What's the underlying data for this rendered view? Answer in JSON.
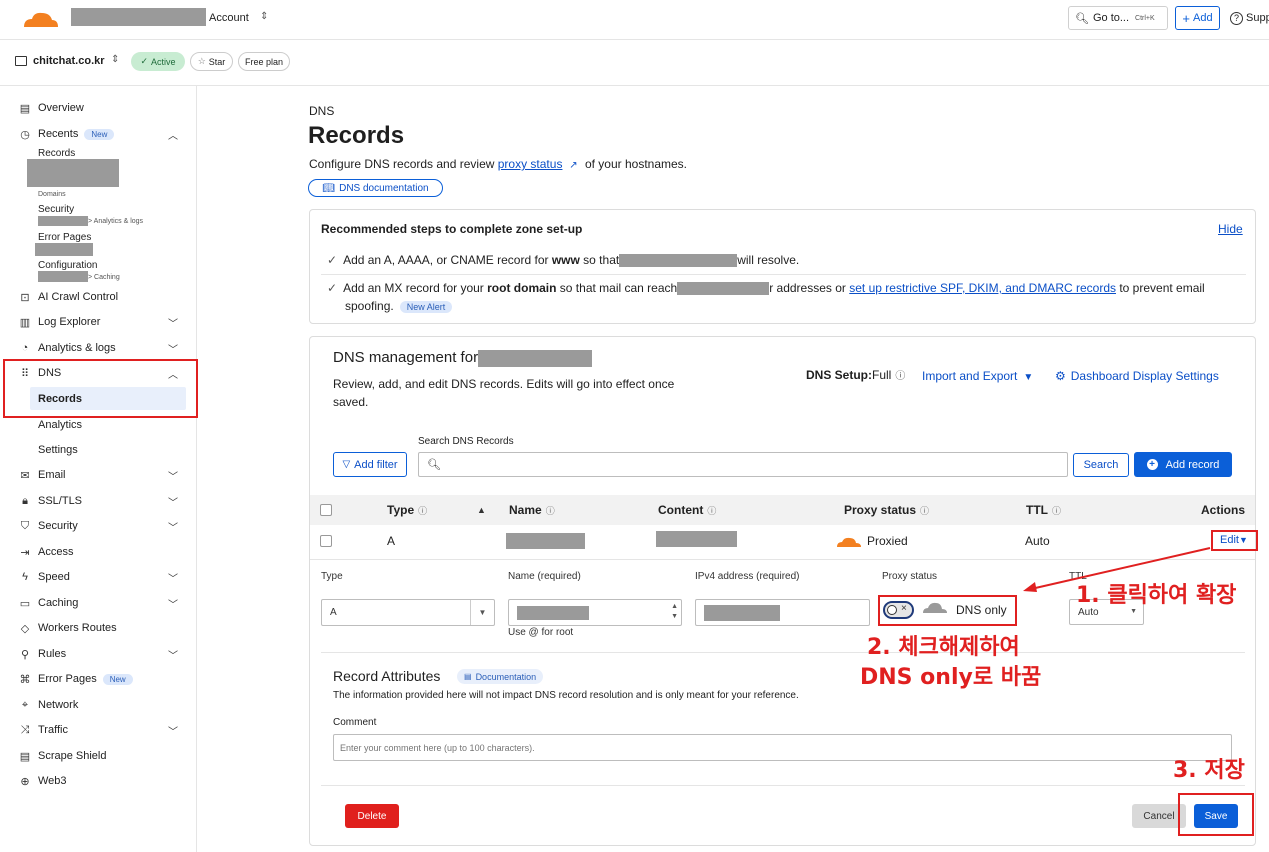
{
  "topbar": {
    "account_label": "Account",
    "goto_label": "Go to...",
    "goto_shortcut": "Ctrl+K",
    "add_label": "Add",
    "support_label": "Supp"
  },
  "zone": {
    "name": "chitchat.co.kr",
    "status": "Active",
    "star": "Star",
    "plan": "Free plan"
  },
  "sidebar": {
    "overview": "Overview",
    "recents": "Recents",
    "recents_badge": "New",
    "recent_records": "Records",
    "recent_domains": "Domains",
    "recent_security": "Security",
    "recent_security_sub": "> Analytics & logs",
    "recent_error_pages": "Error Pages",
    "recent_configuration": "Configuration",
    "recent_configuration_sub": "> Caching",
    "ai_crawl": "AI Crawl Control",
    "log_explorer": "Log Explorer",
    "analytics_logs": "Analytics & logs",
    "dns": "DNS",
    "dns_records": "Records",
    "dns_analytics": "Analytics",
    "dns_settings": "Settings",
    "email": "Email",
    "ssl": "SSL/TLS",
    "security": "Security",
    "access": "Access",
    "speed": "Speed",
    "caching": "Caching",
    "workers": "Workers Routes",
    "rules": "Rules",
    "error_pages": "Error Pages",
    "error_pages_badge": "New",
    "network": "Network",
    "traffic": "Traffic",
    "scrape": "Scrape Shield",
    "web3": "Web3"
  },
  "page": {
    "eyebrow": "DNS",
    "title": "Records",
    "desc_pre": "Configure DNS records and review ",
    "desc_link": "proxy status",
    "desc_post": " of your hostnames.",
    "doc_button": "DNS documentation"
  },
  "steps": {
    "title": "Recommended steps to complete zone set-up",
    "hide": "Hide",
    "step1_pre": "Add an A, AAAA, or CNAME record for ",
    "step1_bold": "www",
    "step1_mid": " so that",
    "step1_post": "will resolve.",
    "step2_pre": "Add an MX record for your ",
    "step2_bold": "root domain",
    "step2_mid": " so that mail can reach",
    "step2_mid2": "r addresses or ",
    "step2_link": "set up restrictive SPF, DKIM, and DMARC records",
    "step2_post": " to prevent email",
    "step2_line2": "spoofing.",
    "step2_badge": "New Alert"
  },
  "mgmt": {
    "title": "DNS management for",
    "desc": "Review, add, and edit DNS records. Edits will go into effect once saved.",
    "setup_label": "DNS Setup:",
    "setup_value": "Full",
    "import_export": "Import and Export",
    "display_settings": "Dashboard Display Settings",
    "search_label": "Search DNS Records",
    "add_filter": "Add filter",
    "search_btn": "Search",
    "add_record": "Add record"
  },
  "table": {
    "headers": {
      "type": "Type",
      "name": "Name",
      "content": "Content",
      "proxy": "Proxy status",
      "ttl": "TTL",
      "actions": "Actions"
    },
    "row": {
      "type": "A",
      "proxy": "Proxied",
      "ttl": "Auto",
      "edit": "Edit"
    }
  },
  "editor": {
    "type_label": "Type",
    "type_value": "A",
    "name_label": "Name (required)",
    "name_hint": "Use @ for root",
    "ipv4_label": "IPv4 address (required)",
    "proxy_label": "Proxy status",
    "proxy_value": "DNS only",
    "ttl_label": "TTL",
    "ttl_value": "Auto",
    "attr_title": "Record Attributes",
    "attr_doc": "Documentation",
    "attr_desc": "The information provided here will not impact DNS record resolution and is only meant for your reference.",
    "comment_label": "Comment",
    "comment_placeholder": "Enter your comment here (up to 100 characters).",
    "delete": "Delete",
    "cancel": "Cancel",
    "save": "Save"
  },
  "annotations": {
    "step1": "1. 클릭하여 확장",
    "step2_line1": "2. 체크해제하여",
    "step2_line2": "DNS only로 바꿈",
    "step3": "3. 저장"
  },
  "colors": {
    "accent": "#0b5fd8",
    "orange": "#f38020",
    "danger": "#e0201d",
    "annotation": "#e02020"
  }
}
